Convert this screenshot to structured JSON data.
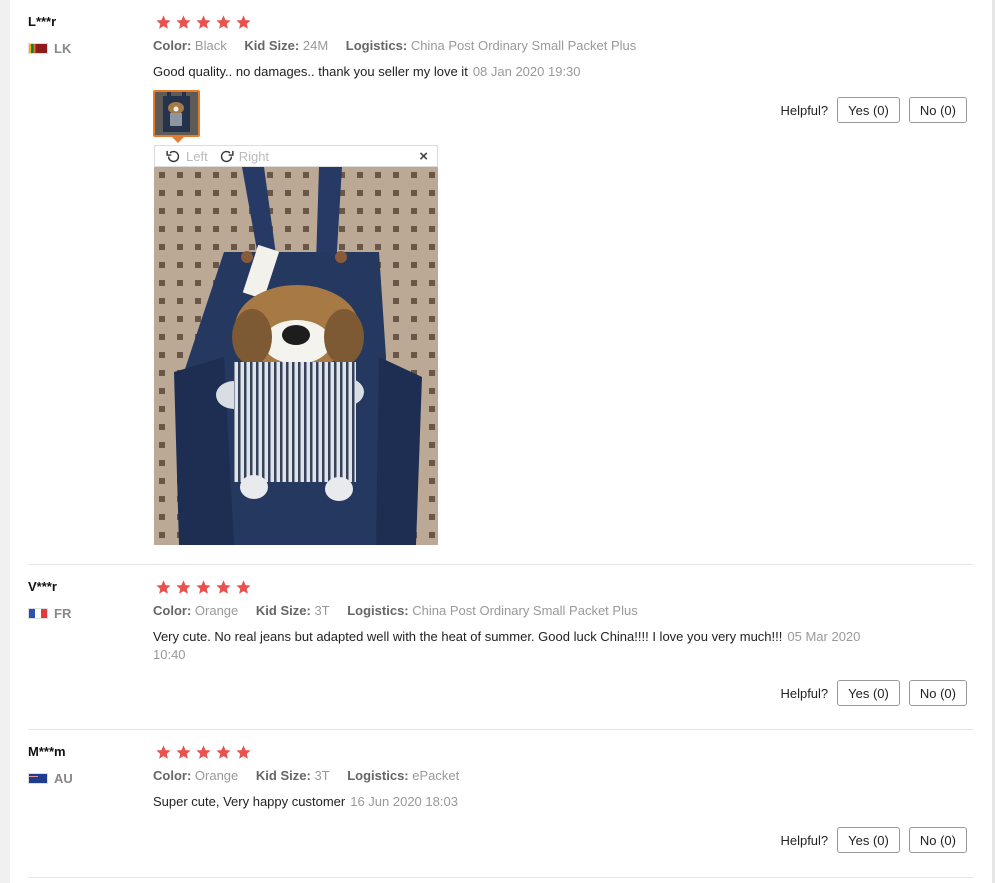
{
  "labels": {
    "color": "Color:",
    "kid_size": "Kid Size:",
    "logistics": "Logistics:",
    "helpful": "Helpful?"
  },
  "colors": {
    "star": "#e8524f",
    "thumb_border": "#e77b2d"
  },
  "reviews": [
    {
      "user": "L***r",
      "country": "LK",
      "flag": "sri-lanka-flag",
      "rating": 5,
      "color": "Black",
      "kid_size": "24M",
      "logistics": "China Post Ordinary Small Packet Plus",
      "text": "Good quality.. no damages.. thank you seller my love it",
      "date": "08 Jan 2020 19:30",
      "yes": "Yes (0)",
      "no": "No (0)",
      "viewer": {
        "left": "Left",
        "right": "Right",
        "close": "×"
      }
    },
    {
      "user": "V***r",
      "country": "FR",
      "flag": "france-flag",
      "rating": 5,
      "color": "Orange",
      "kid_size": "3T",
      "logistics": "China Post Ordinary Small Packet Plus",
      "text": "Very cute. No real jeans but adapted well with the heat of summer. Good luck China!!!! I love you very much!!!",
      "date": "05 Mar 2020 10:40",
      "yes": "Yes (0)",
      "no": "No (0)"
    },
    {
      "user": "M***m",
      "country": "AU",
      "flag": "australia-flag",
      "rating": 5,
      "color": "Orange",
      "kid_size": "3T",
      "logistics": "ePacket",
      "text": "Super cute, Very happy customer",
      "date": "16 Jun 2020 18:03",
      "yes": "Yes (0)",
      "no": "No (0)"
    }
  ]
}
